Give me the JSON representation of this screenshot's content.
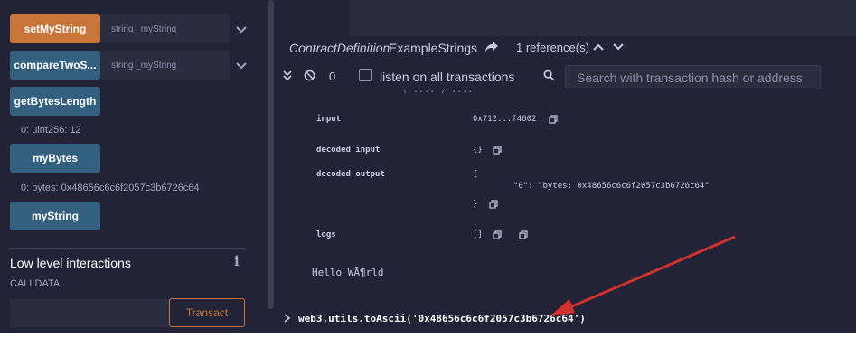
{
  "functions": [
    {
      "label": "setMyString",
      "input_placeholder": "string _myString",
      "style": "orange",
      "expandable": true
    },
    {
      "label": "compareTwoS...",
      "input_placeholder": "string _myString",
      "style": "blue",
      "expandable": true
    },
    {
      "label": "getBytesLength",
      "result": "0: uint256: 12",
      "style": "blue"
    },
    {
      "label": "myBytes",
      "result": "0: bytes: 0x48656c6c6f2057c3b6726c64",
      "style": "blue"
    },
    {
      "label": "myString",
      "style": "blue"
    }
  ],
  "low_level": {
    "title": "Low level interactions",
    "info_icon": "info-icon",
    "calldata_label": "CALLDATA",
    "transact_label": "Transact"
  },
  "editor_bar": {
    "kind": "ContractDefinition",
    "name": "ExampleStrings",
    "references": "1 reference(s)"
  },
  "terminal": {
    "pending_count": "0",
    "listen_label": "listen on all transactions",
    "search_placeholder": "Search with transaction hash or address",
    "cut_line": "( .... ) ....",
    "tx_rows": {
      "input_key": "input",
      "input_value": "0x712...f4602",
      "decoded_input_key": "decoded input",
      "decoded_input_value": "{}",
      "decoded_output_key": "decoded output",
      "decoded_output_open": "{",
      "decoded_output_line": "\"0\": \"bytes: 0x48656c6c6f2057c3b6726c64\"",
      "decoded_output_close": "}",
      "logs_key": "logs",
      "logs_value": "[]"
    },
    "output": "Hello WÃ¶rld",
    "command": "web3.utils.toAscii('0x48656c6c6f2057c3b6726c64')"
  },
  "colors": {
    "background": "#222336",
    "accent_orange": "#c97539",
    "button_blue": "#34607f",
    "annotation_arrow": "#d0312d"
  }
}
